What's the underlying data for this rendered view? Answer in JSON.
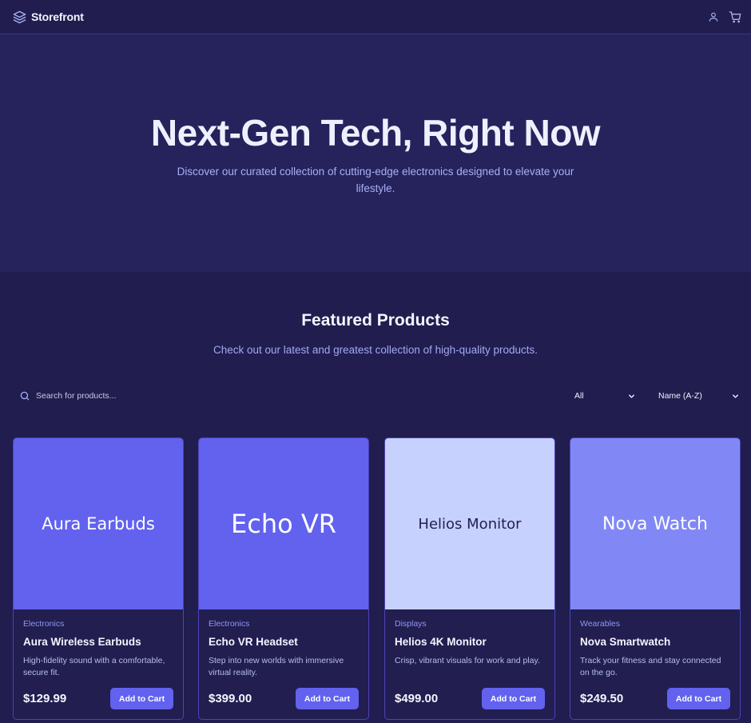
{
  "header": {
    "brand": "Storefront",
    "icons": {
      "logo": "layers-icon",
      "account": "user-icon",
      "cart": "cart-icon"
    }
  },
  "hero": {
    "title": "Next-Gen Tech, Right Now",
    "subtitle": "Discover our curated collection of cutting-edge electronics designed to elevate your lifestyle."
  },
  "featured": {
    "title": "Featured Products",
    "subtitle": "Check out our latest and greatest collection of high-quality products."
  },
  "toolbar": {
    "search_placeholder": "Search for products...",
    "category_selected": "All",
    "sort_selected": "Name (A-Z)"
  },
  "products": [
    {
      "image_text": "Aura Earbuds",
      "image_bg": "#6262ef",
      "image_fg": "#ffffff",
      "category": "Electronics",
      "name": "Aura Wireless Earbuds",
      "description": "High-fidelity sound with a comfortable, secure fit.",
      "price": "$129.99",
      "button": "Add to Cart"
    },
    {
      "image_text": "Echo VR",
      "image_bg": "#6262ef",
      "image_fg": "#ffffff",
      "category": "Electronics",
      "name": "Echo VR Headset",
      "description": "Step into new worlds with immersive virtual reality.",
      "price": "$399.00",
      "button": "Add to Cart"
    },
    {
      "image_text": "Helios Monitor",
      "image_bg": "#c7d1fe",
      "image_fg": "#221e50",
      "category": "Displays",
      "name": "Helios 4K Monitor",
      "description": "Crisp, vibrant visuals for work and play.",
      "price": "$499.00",
      "button": "Add to Cart"
    },
    {
      "image_text": "Nova Watch",
      "image_bg": "#8188f5",
      "image_fg": "#ffffff",
      "category": "Wearables",
      "name": "Nova Smartwatch",
      "description": "Track your fitness and stay connected on the go.",
      "price": "$249.50",
      "button": "Add to Cart"
    }
  ]
}
